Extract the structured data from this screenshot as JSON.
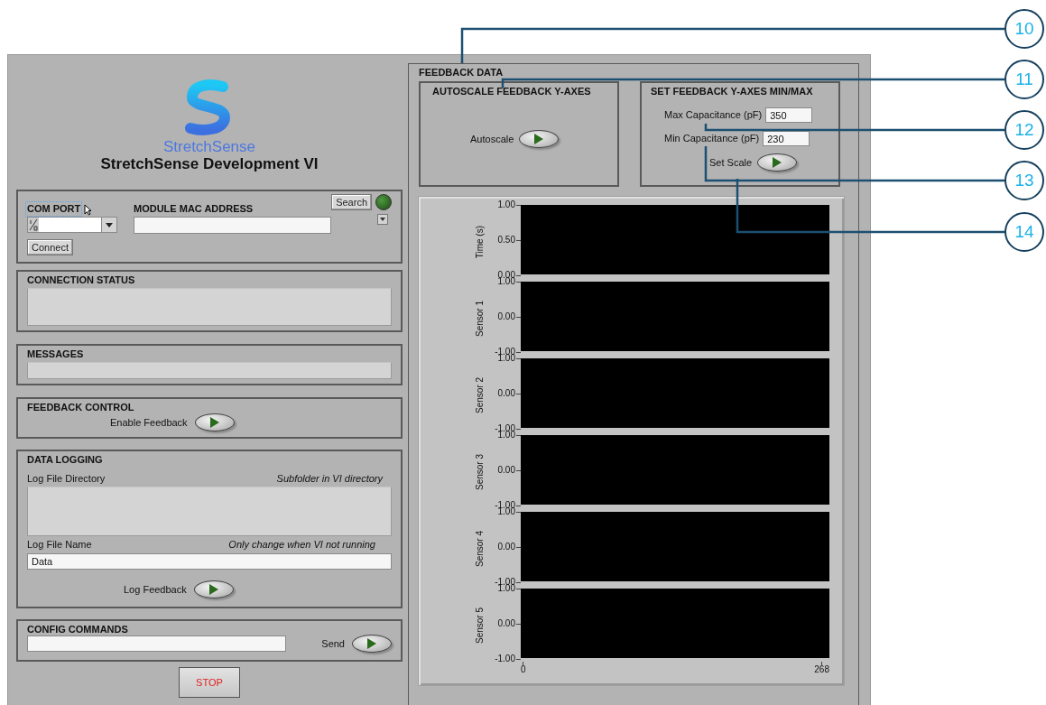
{
  "logo": {
    "brand": "StretchSense",
    "title": "StretchSense Development VI"
  },
  "connection": {
    "com_port": {
      "label": "COM PORT",
      "selected": true
    },
    "mac_label": "MODULE MAC ADDRESS",
    "search_button": "Search",
    "led_on": false,
    "connect_button": "Connect"
  },
  "connection_status": {
    "title": "CONNECTION STATUS"
  },
  "messages": {
    "title": "MESSAGES"
  },
  "feedback_control": {
    "title": "FEEDBACK CONTROL",
    "toggle": {
      "label": "Enable Feedback",
      "on": false
    }
  },
  "data_logging": {
    "title": "DATA LOGGING",
    "directory_label": "Log File Directory",
    "directory_hint": "Subfolder in VI directory",
    "name_label": "Log File Name",
    "name_hint": "Only change when VI not running",
    "file_name": "Data",
    "toggle": {
      "label": "Log Feedback",
      "on": false
    }
  },
  "config_commands": {
    "title": "CONFIG COMMANDS",
    "toggle": {
      "label": "Send",
      "on": false
    }
  },
  "stop_button": "STOP",
  "feedback_data": {
    "title": "FEEDBACK DATA",
    "autoscale": {
      "title": "AUTOSCALE FEEDBACK Y-AXES",
      "toggle": {
        "label": "Autoscale",
        "on": false
      }
    },
    "set_scale": {
      "title": "SET FEEDBACK Y-AXES MIN/MAX",
      "max_label": "Max Capacitance (pF)",
      "max_value": "350",
      "min_label": "Min Capacitance (pF)",
      "min_value": "230",
      "toggle": {
        "label": "Set Scale",
        "on": false
      }
    },
    "graphs": [
      {
        "axis_label": "Time (s)",
        "ticks": [
          "1.00",
          "0.50",
          "0.00"
        ]
      },
      {
        "axis_label": "Sensor 1",
        "ticks": [
          "1.00",
          "0.00",
          "-1.00"
        ]
      },
      {
        "axis_label": "Sensor 2",
        "ticks": [
          "1.00",
          "0.00",
          "-1.00"
        ]
      },
      {
        "axis_label": "Sensor 3",
        "ticks": [
          "1.00",
          "0.00",
          "-1.00"
        ]
      },
      {
        "axis_label": "Sensor 4",
        "ticks": [
          "1.00",
          "0.00",
          "-1.00"
        ]
      },
      {
        "axis_label": "Sensor 5",
        "ticks": [
          "1.00",
          "0.00",
          "-1.00"
        ]
      }
    ],
    "x_ticks": [
      "0",
      "268"
    ]
  },
  "callouts": [
    "10",
    "11",
    "12",
    "13",
    "14"
  ]
}
